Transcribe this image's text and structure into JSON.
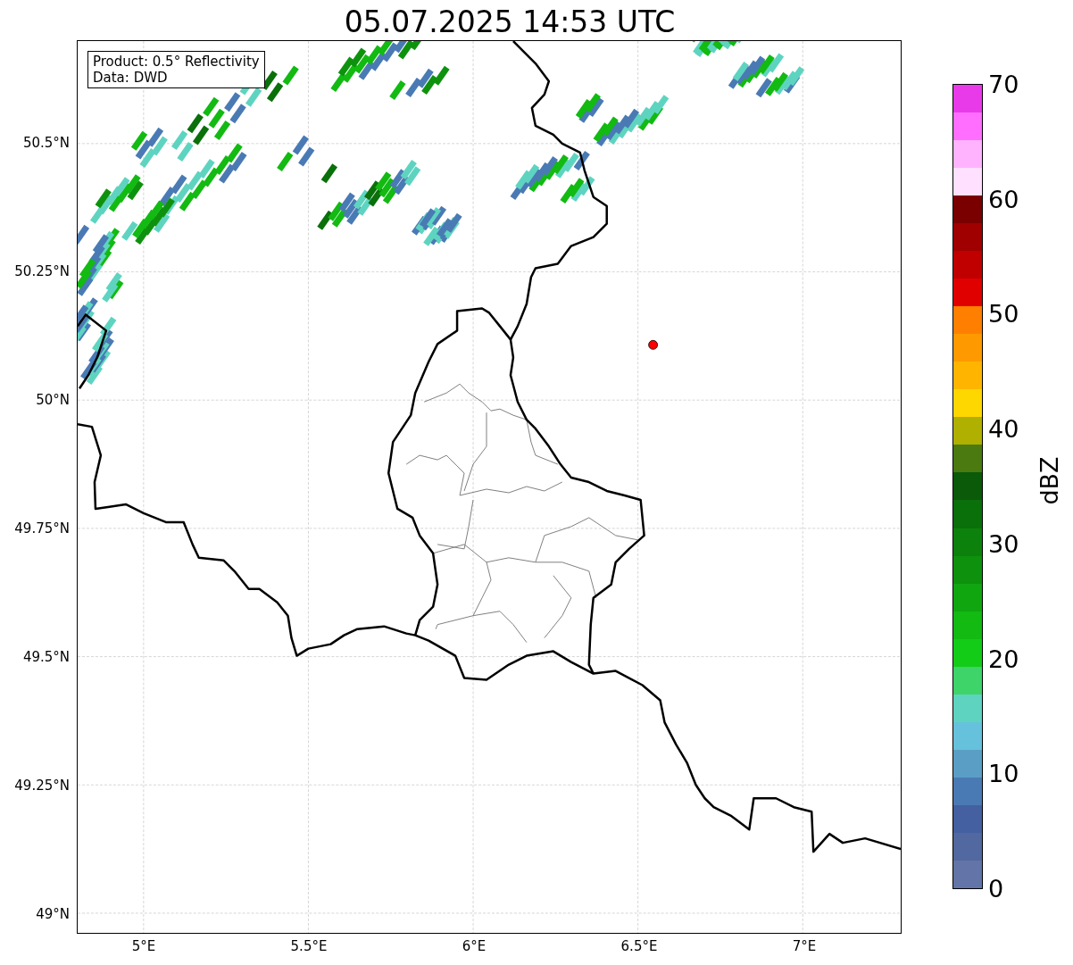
{
  "title": "05.07.2025 14:53 UTC",
  "info_box": [
    "Product: 0.5° Reflectivity",
    "Data: DWD"
  ],
  "y_ticks": [
    "50.5°N",
    "50.25°N",
    "50°N",
    "49.75°N",
    "49.5°N",
    "49.25°N",
    "49°N"
  ],
  "x_ticks": [
    "5°E",
    "5.5°E",
    "6°E",
    "6.5°E",
    "7°E"
  ],
  "colorbar": {
    "label": "dBZ",
    "ticks": [
      "70",
      "60",
      "50",
      "40",
      "30",
      "20",
      "10",
      "0"
    ],
    "segments": [
      {
        "color": "#6274a8"
      },
      {
        "color": "#5268a0"
      },
      {
        "color": "#4460a0"
      },
      {
        "color": "#4a7ab4"
      },
      {
        "color": "#5a9ec6"
      },
      {
        "color": "#66c2dc"
      },
      {
        "color": "#5ed4c0"
      },
      {
        "color": "#3ed46a"
      },
      {
        "color": "#12cc18"
      },
      {
        "color": "#12ba12"
      },
      {
        "color": "#10a610"
      },
      {
        "color": "#0e920e"
      },
      {
        "color": "#0c820c"
      },
      {
        "color": "#0a700a"
      },
      {
        "color": "#0a5a0a"
      },
      {
        "color": "#4a7a10"
      },
      {
        "color": "#b0b000"
      },
      {
        "color": "#ffd700"
      },
      {
        "color": "#ffb500"
      },
      {
        "color": "#ff9900"
      },
      {
        "color": "#ff7f00"
      },
      {
        "color": "#e00000"
      },
      {
        "color": "#c00000"
      },
      {
        "color": "#a00000"
      },
      {
        "color": "#7a0000"
      },
      {
        "color": "#ffe0ff"
      },
      {
        "color": "#ffb3ff"
      },
      {
        "color": "#ff6eff"
      },
      {
        "color": "#e93ae9"
      }
    ]
  }
}
